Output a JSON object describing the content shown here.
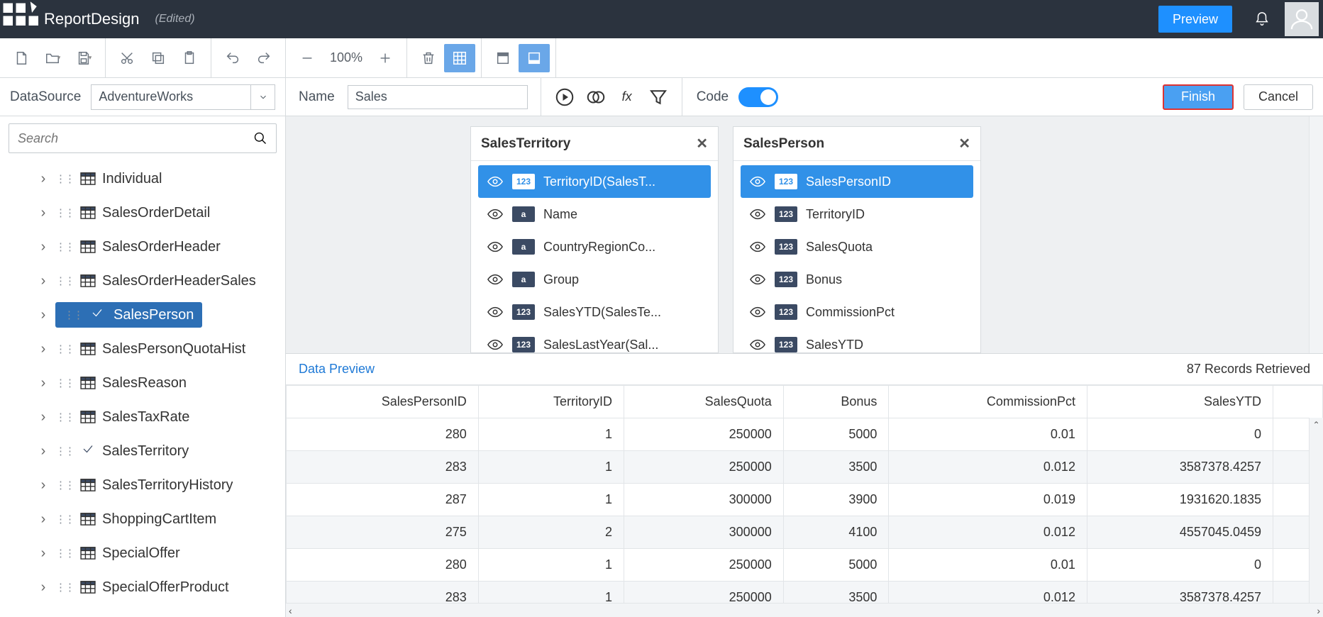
{
  "header": {
    "title": "ReportDesign",
    "status": "(Edited)",
    "preview": "Preview"
  },
  "toolbar": {
    "zoom": "100%"
  },
  "config": {
    "datasource_label": "DataSource",
    "datasource_value": "AdventureWorks",
    "name_label": "Name",
    "name_value": "Sales",
    "code_label": "Code",
    "finish": "Finish",
    "cancel": "Cancel"
  },
  "sidebar": {
    "search_placeholder": "Search",
    "items": [
      {
        "label": "Individual",
        "type": "table"
      },
      {
        "label": "SalesOrderDetail",
        "type": "table"
      },
      {
        "label": "SalesOrderHeader",
        "type": "table"
      },
      {
        "label": "SalesOrderHeaderSales",
        "type": "table"
      },
      {
        "label": "SalesPerson",
        "type": "check",
        "selected": true
      },
      {
        "label": "SalesPersonQuotaHist",
        "type": "table"
      },
      {
        "label": "SalesReason",
        "type": "table"
      },
      {
        "label": "SalesTaxRate",
        "type": "table"
      },
      {
        "label": "SalesTerritory",
        "type": "check"
      },
      {
        "label": "SalesTerritoryHistory",
        "type": "table"
      },
      {
        "label": "ShoppingCartItem",
        "type": "table"
      },
      {
        "label": "SpecialOffer",
        "type": "table"
      },
      {
        "label": "SpecialOfferProduct",
        "type": "table"
      }
    ]
  },
  "panels": [
    {
      "title": "SalesTerritory",
      "fields": [
        {
          "name": "TerritoryID(SalesT...",
          "type": "123",
          "selected": true
        },
        {
          "name": "Name",
          "type": "a"
        },
        {
          "name": "CountryRegionCo...",
          "type": "a"
        },
        {
          "name": "Group",
          "type": "a"
        },
        {
          "name": "SalesYTD(SalesTe...",
          "type": "123"
        },
        {
          "name": "SalesLastYear(Sal...",
          "type": "123"
        }
      ]
    },
    {
      "title": "SalesPerson",
      "fields": [
        {
          "name": "SalesPersonID",
          "type": "123",
          "selected": true
        },
        {
          "name": "TerritoryID",
          "type": "123"
        },
        {
          "name": "SalesQuota",
          "type": "123"
        },
        {
          "name": "Bonus",
          "type": "123"
        },
        {
          "name": "CommissionPct",
          "type": "123"
        },
        {
          "name": "SalesYTD",
          "type": "123"
        }
      ]
    }
  ],
  "preview": {
    "title": "Data Preview",
    "records": "87 Records Retrieved",
    "columns": [
      "SalesPersonID",
      "TerritoryID",
      "SalesQuota",
      "Bonus",
      "CommissionPct",
      "SalesYTD"
    ],
    "rows": [
      [
        "280",
        "1",
        "250000",
        "5000",
        "0.01",
        "0"
      ],
      [
        "283",
        "1",
        "250000",
        "3500",
        "0.012",
        "3587378.4257"
      ],
      [
        "287",
        "1",
        "300000",
        "3900",
        "0.019",
        "1931620.1835"
      ],
      [
        "275",
        "2",
        "300000",
        "4100",
        "0.012",
        "4557045.0459"
      ],
      [
        "280",
        "1",
        "250000",
        "5000",
        "0.01",
        "0"
      ],
      [
        "283",
        "1",
        "250000",
        "3500",
        "0.012",
        "3587378.4257"
      ]
    ]
  }
}
